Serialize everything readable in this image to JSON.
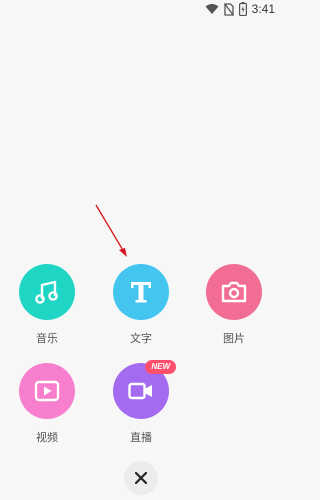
{
  "status_bar": {
    "time": "3:41",
    "icons": [
      "wifi-icon",
      "no-sim-icon",
      "battery-charging-icon"
    ]
  },
  "menu": {
    "items": [
      {
        "label": "音乐",
        "icon": "music-note-icon",
        "color": "#1fd6c5"
      },
      {
        "label": "文字",
        "icon": "text-t-icon",
        "color": "#44c5f0"
      },
      {
        "label": "图片",
        "icon": "camera-icon",
        "color": "#f26d93"
      },
      {
        "label": "视频",
        "icon": "play-icon",
        "color": "#f77fce"
      },
      {
        "label": "直播",
        "icon": "video-camera-icon",
        "color": "#a46bf0",
        "badge": "NEW"
      }
    ]
  },
  "close": {
    "icon": "close-icon"
  },
  "annotation": {
    "color": "#d4161c"
  }
}
